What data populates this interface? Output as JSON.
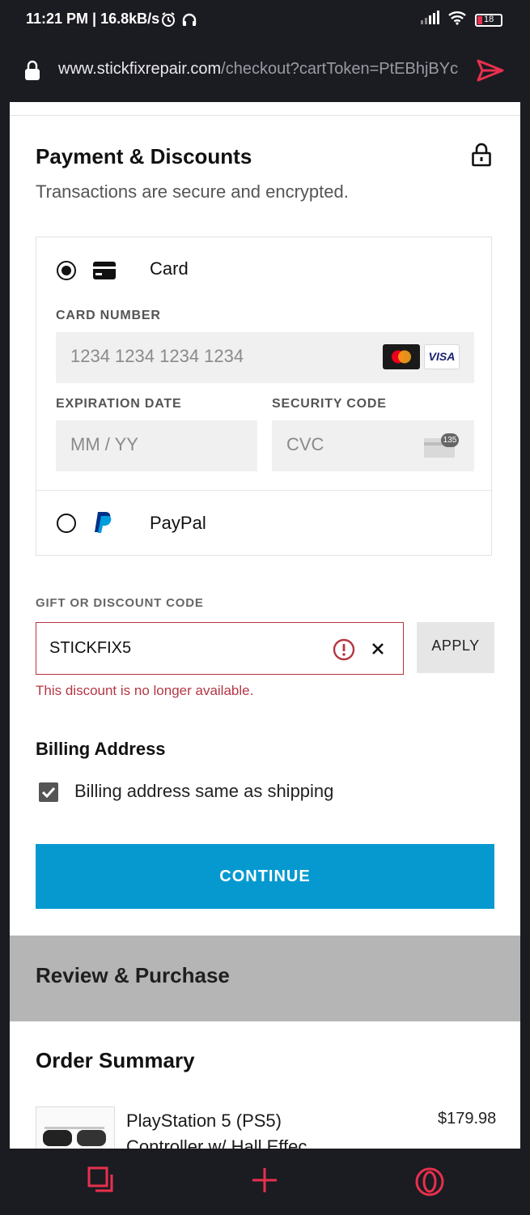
{
  "status_bar": {
    "time": "11:21 PM | 16.8kB/s",
    "battery": "18",
    "icons": [
      "alarm-icon",
      "headphones-icon",
      "signal-icon",
      "wifi-icon",
      "battery-icon"
    ]
  },
  "browser": {
    "url_host": "www.stickfixrepair.com",
    "url_path": "/checkout?cartToken=PtEBhjBYc"
  },
  "payment": {
    "title": "Payment & Discounts",
    "subtitle": "Transactions are secure and encrypted.",
    "card_option_label": "Card",
    "card_number_label": "CARD NUMBER",
    "card_number_placeholder": "1234 1234 1234 1234",
    "expiration_label": "EXPIRATION DATE",
    "expiration_placeholder": "MM / YY",
    "security_label": "SECURITY CODE",
    "security_placeholder": "CVC",
    "cvc_badge": "135",
    "visa_label": "VISA",
    "paypal_option_label": "PayPal",
    "selected_method": "card"
  },
  "discount": {
    "label": "GIFT OR DISCOUNT CODE",
    "value": "STICKFIX5",
    "apply_label": "APPLY",
    "error": "This discount is no longer available."
  },
  "billing": {
    "title": "Billing Address",
    "same_as_shipping_label": "Billing address same as shipping",
    "same_as_shipping_checked": true
  },
  "continue_label": "CONTINUE",
  "review_title": "Review & Purchase",
  "order_summary": {
    "title": "Order Summary",
    "items": [
      {
        "name": "PlayStation 5 (PS5) Controller w/ Hall Effec",
        "price": "$179.98"
      }
    ]
  },
  "colors": {
    "accent": "#0599d0",
    "error": "#b43745",
    "browser_accent": "#e8304d",
    "browser_bg": "#1b1b22"
  }
}
